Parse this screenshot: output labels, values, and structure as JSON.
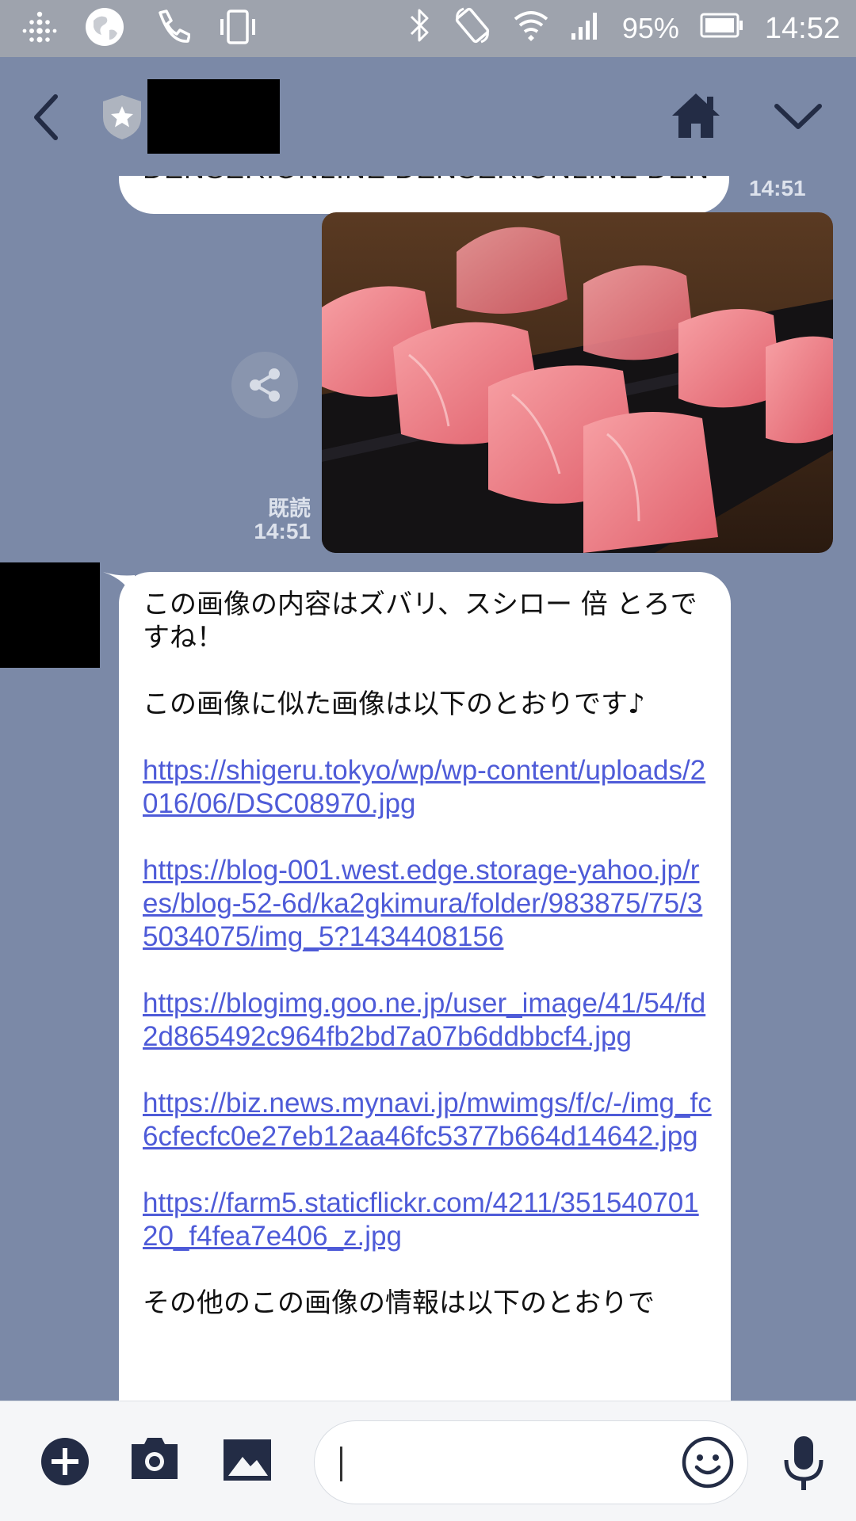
{
  "status_bar": {
    "battery_percent": "95%",
    "time": "14:52",
    "icons": [
      "fitbit-icon",
      "globe-icon",
      "phone-icon",
      "vibrate-icon",
      "bluetooth-icon",
      "rotate-icon",
      "wifi-icon",
      "signal-icon",
      "battery-icon"
    ]
  },
  "header": {
    "icons": [
      "back-arrow-icon",
      "shield-star-icon",
      "home-icon",
      "chevron-down-icon"
    ]
  },
  "chat": {
    "previous_message": {
      "text": "DENSERIONLINE DENSERIONLINE DEN",
      "time": "14:51"
    },
    "image_message": {
      "read_label": "既読",
      "time": "14:51",
      "share_icon": "share-icon"
    },
    "bot_message": {
      "paragraph1": "この画像の内容はズバリ、スシロー 倍 とろですね！",
      "paragraph2": "この画像に似た画像は以下のとおりです♪",
      "links": [
        "https://shigeru.tokyo/wp/wp-content/uploads/2016/06/DSC08970.jpg",
        "https://blog-001.west.edge.storage-yahoo.jp/res/blog-52-6d/ka2gkimura/folder/983875/75/35034075/img_5?1434408156",
        "https://blogimg.goo.ne.jp/user_image/41/54/fd2d865492c964fb2bd7a07b6ddbbcf4.jpg",
        "https://biz.news.mynavi.jp/mwimgs/f/c/-/img_fc6cfecfc0e27eb12aa46fc5377b664d14642.jpg",
        "https://farm5.staticflickr.com/4211/35154070120_f4fea7e406_z.jpg"
      ],
      "paragraph3": "その他のこの画像の情報は以下のとおりで"
    }
  },
  "input_bar": {
    "placeholder": "",
    "icons": [
      "plus-icon",
      "camera-icon",
      "image-icon",
      "emoji-icon",
      "microphone-icon"
    ]
  },
  "colors": {
    "chat_background": "#7b89a7",
    "link": "#4e5bd8",
    "status_bar": "#9ea3ad"
  }
}
